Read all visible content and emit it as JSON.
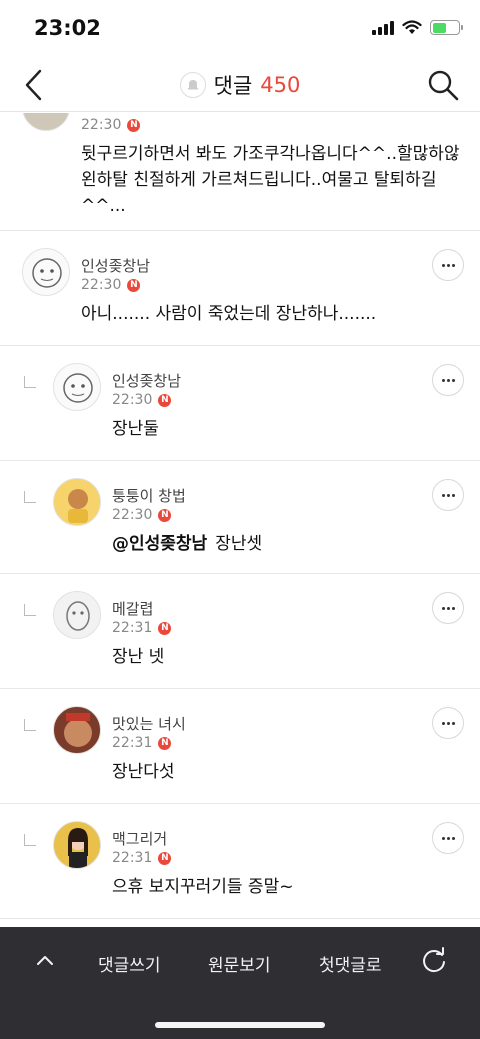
{
  "status": {
    "time": "23:02"
  },
  "header": {
    "title": "댓글",
    "count": "450"
  },
  "comments": [
    {
      "name": "",
      "time": "22:30",
      "new": "N",
      "text": "뒷구르기하면서 봐도 가조쿠각나옵니다^^..할많하않 왼하탈 친절하게 가르쳐드립니다..여물고 탈퇴하길^^..."
    },
    {
      "name": "인성좆창남",
      "time": "22:30",
      "new": "N",
      "text": "아니....... 사람이 죽었는데 장난하나......."
    },
    {
      "name": "인성좆창남",
      "time": "22:30",
      "new": "N",
      "text": "장난둘"
    },
    {
      "name": "퉁퉁이 창법",
      "time": "22:30",
      "new": "N",
      "mention": "@인성좆창남",
      "text": "장난셋"
    },
    {
      "name": "메갈렵",
      "time": "22:31",
      "new": "N",
      "text": "장난 넷"
    },
    {
      "name": "맛있는 녀시",
      "time": "22:31",
      "new": "N",
      "text": "장난다섯"
    },
    {
      "name": "맥그리거",
      "time": "22:31",
      "new": "N",
      "text": "으휴 보지꾸러기들 증말~"
    }
  ],
  "bottom_bar": {
    "write": "댓글쓰기",
    "original": "원문보기",
    "first": "첫댓글로"
  },
  "icons": [
    "back-icon",
    "bell-icon",
    "search-icon",
    "more-icon",
    "reply-icon",
    "up-icon",
    "refresh-icon"
  ],
  "colors": {
    "accent": "#e9483a",
    "bottom_bar": "#2f2f33"
  }
}
